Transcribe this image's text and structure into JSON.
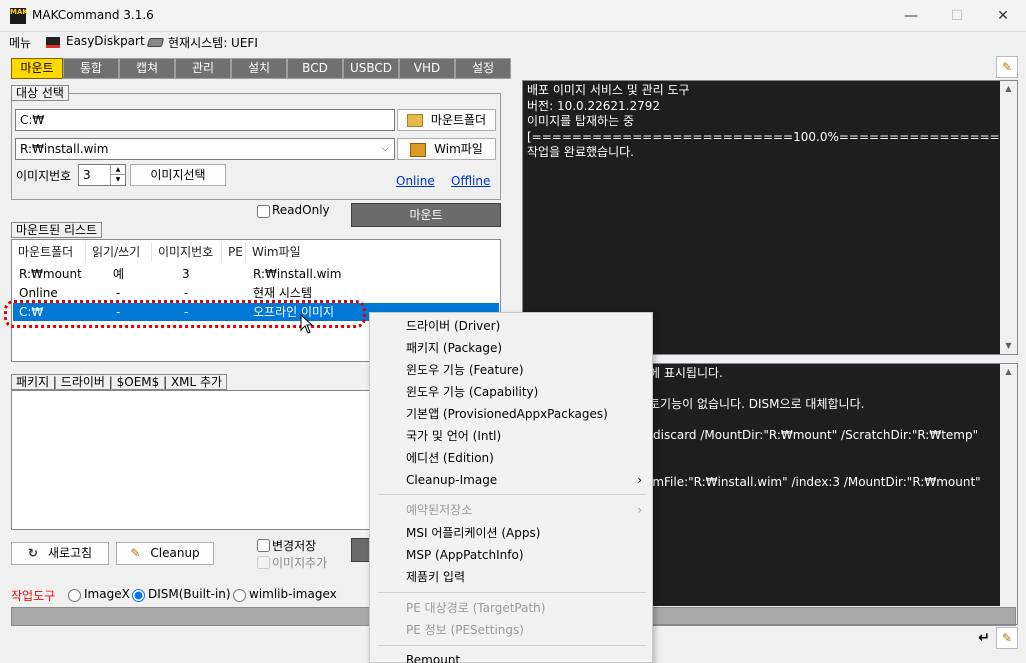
{
  "window": {
    "title": "MAKCommand 3.1.6",
    "controls": {
      "minimize": "—",
      "maximize": "☐",
      "close": "✕"
    }
  },
  "menubar": {
    "items": [
      {
        "label": "메뉴"
      },
      {
        "label": "EasyDiskpart",
        "icon": "disk-icon"
      },
      {
        "label": "현재시스템: UEFI",
        "icon": "drive-icon"
      }
    ]
  },
  "tabs": [
    "마운트",
    "통합",
    "캡쳐",
    "관리",
    "설치",
    "BCD",
    "USBCD",
    "VHD",
    "설정"
  ],
  "target": {
    "group_label": "대상 선택",
    "mount_path": "C:₩",
    "mount_folder_button": "마운트폴더",
    "wim_path": "R:₩install.wim",
    "wim_button": "Wim파일",
    "image_number_label": "이미지번호",
    "image_number": "3",
    "select_image_button": "이미지선택",
    "online_link": "Online",
    "offline_link": "Offline",
    "readonly_label": "ReadOnly",
    "readonly_checked": false,
    "mount_button": "마운트"
  },
  "mounted_list": {
    "group_label": "마운트된 리스트",
    "columns": [
      "마운트폴더",
      "읽기/쓰기",
      "이미지번호",
      "PE",
      "Wim파일"
    ],
    "rows": [
      {
        "folder": "R:₩mount",
        "rw": "예",
        "index": "3",
        "pe": "",
        "wim": "R:₩install.wim"
      },
      {
        "folder": "Online",
        "rw": "-",
        "index": "-",
        "pe": "",
        "wim": "현재 시스템"
      },
      {
        "folder": "C:₩",
        "rw": "-",
        "index": "-",
        "pe": "",
        "wim": "오프라인 이미지"
      }
    ]
  },
  "package_panel": {
    "group_label": "패키지 | 드라이버 | $OEM$ | XML 추가"
  },
  "bottom": {
    "refresh_button": "새로고침",
    "cleanup_button": "Cleanup",
    "save_changes_label": "변경저장",
    "add_image_label": "이미지추가",
    "tools_label": "작업도구",
    "tool_options": [
      "ImageX",
      "DISM(Built-in)",
      "wimlib-imagex"
    ],
    "selected_tool": "DISM(Built-in)"
  },
  "console_top": {
    "lines": [
      "배포 이미지 서비스 및 관리 도구",
      "버전: 10.0.22621.2792",
      "이미지를 탑재하는 중",
      "[==========================100.0%==========================]",
      "작업을 완료했습니다."
    ]
  },
  "console_bottom": {
    "lines": [
      "에 표시됩니다.",
      "",
      "토기능이 없습니다. DISM으로 대체합니다.",
      "",
      "/discard /MountDir:\"R:₩mount\" /ScratchDir:\"R:₩temp\"",
      "",
      "",
      "imFile:\"R:₩install.wim\" /index:3 /MountDir:\"R:₩mount\""
    ]
  },
  "context_menu": {
    "group1": [
      "드라이버 (Driver)",
      "패키지 (Package)",
      "윈도우 기능 (Feature)",
      "윈도우 기능 (Capability)",
      "기본앱 (ProvisionedAppxPackages)",
      "국가 및 언어 (Intl)",
      "에디션 (Edition)",
      "Cleanup-Image"
    ],
    "reserved_storage": "예약된저장소",
    "group2": [
      "MSI 어플리케이션 (Apps)",
      "MSP (AppPatchInfo)",
      "제품키 입력"
    ],
    "group3": [
      "PE 대상경로 (TargetPath)",
      "PE 정보 (PESettings)"
    ],
    "remount": "Remount"
  },
  "colors": {
    "active_tab": "#ffd800",
    "tab": "#707070",
    "selection": "#0078d7",
    "console_bg": "#1e1e1e",
    "highlight_ring": "#e00000"
  }
}
